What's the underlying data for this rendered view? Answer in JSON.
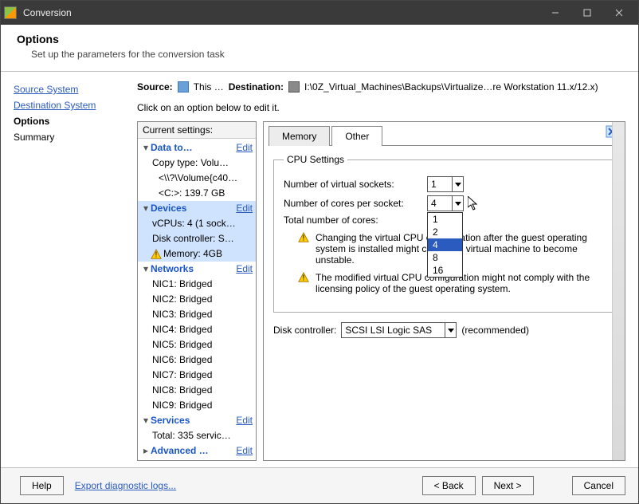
{
  "window": {
    "title": "Conversion"
  },
  "winctrl": {
    "min": "min",
    "max": "max",
    "close": "close"
  },
  "header": {
    "title": "Options",
    "subtitle": "Set up the parameters for the conversion task"
  },
  "nav": {
    "source_system": "Source System",
    "destination_system": "Destination System",
    "options": "Options",
    "summary": "Summary"
  },
  "source": {
    "label": "Source:",
    "value": "This …",
    "dest_label": "Destination:",
    "dest_value": "I:\\0Z_Virtual_Machines\\Backups\\Virtualize…re Workstation 11.x/12.x)"
  },
  "hint": "Click on an option below to edit it.",
  "tree": {
    "header": "Current settings:",
    "edit": "Edit",
    "items": {
      "data_to": "Data to…",
      "copy_type": "Copy type: Volu…",
      "vol1": "<\\\\?\\Volume{c40…",
      "vol2": "<C:>: 139.7 GB",
      "devices": "Devices",
      "vcpus": "vCPUs: 4 (1 sock…",
      "diskctrl": "Disk controller: S…",
      "memory": "Memory: 4GB",
      "networks": "Networks",
      "nic1": "NIC1: Bridged",
      "nic2": "NIC2: Bridged",
      "nic3": "NIC3: Bridged",
      "nic4": "NIC4: Bridged",
      "nic5": "NIC5: Bridged",
      "nic6": "NIC6: Bridged",
      "nic7": "NIC7: Bridged",
      "nic8": "NIC8: Bridged",
      "nic9": "NIC9: Bridged",
      "services": "Services",
      "total_services": "Total: 335 servic…",
      "advanced": "Advanced …"
    }
  },
  "tabs": {
    "memory": "Memory",
    "other": "Other"
  },
  "cpu": {
    "legend": "CPU Settings",
    "sockets_label": "Number of virtual sockets:",
    "sockets_value": "1",
    "cores_label": "Number of cores per socket:",
    "cores_value": "4",
    "cores_options": [
      "1",
      "2",
      "4",
      "8",
      "16"
    ],
    "total_label": "Total number of cores:",
    "warn1": "Changing the virtual CPU configuration after the guest operating system is installed might cause the virtual machine to become unstable.",
    "warn2": "The modified virtual CPU configuration might not comply with the licensing policy of the guest operating system."
  },
  "disk": {
    "label": "Disk controller:",
    "value": "SCSI LSI Logic SAS",
    "rec": "(recommended)"
  },
  "footer": {
    "help": "Help",
    "diag": "Export diagnostic logs...",
    "back": "< Back",
    "next": "Next >",
    "cancel": "Cancel"
  }
}
